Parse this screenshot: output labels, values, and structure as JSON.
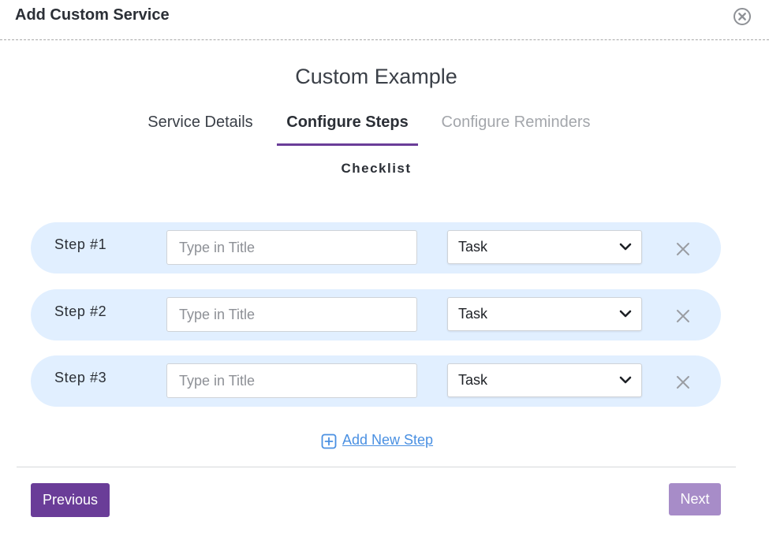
{
  "modal": {
    "title": "Add Custom Service"
  },
  "service": {
    "name": "Custom Example"
  },
  "tabs": [
    {
      "label": "Service Details",
      "state": "completed"
    },
    {
      "label": "Configure Steps",
      "state": "active"
    },
    {
      "label": "Configure Reminders",
      "state": "pending"
    }
  ],
  "section": {
    "title": "Checklist"
  },
  "steps": [
    {
      "label": "Step #1",
      "title_value": "",
      "title_placeholder": "Type in Title",
      "type": "Task"
    },
    {
      "label": "Step #2",
      "title_value": "",
      "title_placeholder": "Type in Title",
      "type": "Task"
    },
    {
      "label": "Step #3",
      "title_value": "",
      "title_placeholder": "Type in Title",
      "type": "Task"
    }
  ],
  "add_step": {
    "label": "Add New Step",
    "icon": "plus-square-icon"
  },
  "footer": {
    "previous_label": "Previous",
    "next_label": "Next"
  },
  "colors": {
    "accent": "#6a3d98",
    "accent_disabled": "#a78cc8",
    "step_row_bg": "#e1efff",
    "link": "#4a90e2"
  },
  "icons": {
    "close": "close-circle-icon",
    "select": "chevron-down-icon",
    "remove": "x-icon"
  }
}
